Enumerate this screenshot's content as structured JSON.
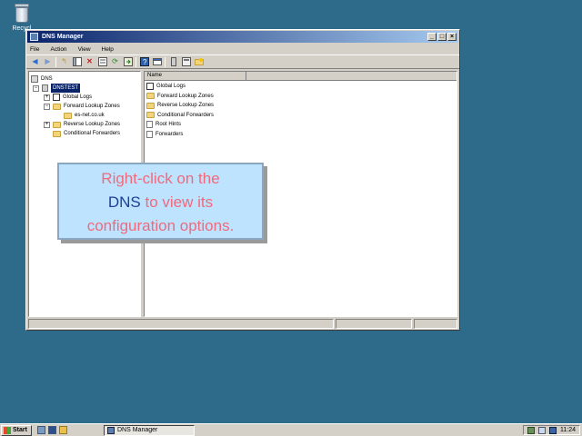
{
  "desktop": {
    "recycle_label": "Recycl"
  },
  "window": {
    "title": "DNS Manager",
    "controls": {
      "minimize": "_",
      "maximize": "□",
      "close": "×"
    }
  },
  "menu": [
    "File",
    "Action",
    "View",
    "Help"
  ],
  "toolbar_icons": [
    "back-icon",
    "forward-icon",
    "up-icon",
    "show-hide-tree-icon",
    "delete-icon",
    "properties-icon",
    "refresh-icon",
    "export-icon",
    "help-icon",
    "new-window-icon",
    "server-icon",
    "zone-icon",
    "folder-icon"
  ],
  "tree": {
    "root": "DNS",
    "server": "DNSTEST",
    "items": [
      {
        "label": "Global Logs",
        "level": 2,
        "expander": "+"
      },
      {
        "label": "Forward Lookup Zones",
        "level": 2,
        "expander": "−"
      },
      {
        "label": "es-net.co.uk",
        "level": 3,
        "expander": ""
      },
      {
        "label": "Reverse Lookup Zones",
        "level": 2,
        "expander": "+"
      },
      {
        "label": "Conditional Forwarders",
        "level": 2,
        "expander": ""
      }
    ]
  },
  "list": {
    "columns": [
      "Name"
    ],
    "items": [
      {
        "label": "Global Logs",
        "icon": "global-logs-icon"
      },
      {
        "label": "Forward Lookup Zones",
        "icon": "folder-icon"
      },
      {
        "label": "Reverse Lookup Zones",
        "icon": "folder-icon"
      },
      {
        "label": "Conditional Forwarders",
        "icon": "folder-icon"
      },
      {
        "label": "Root Hints",
        "icon": "document-icon"
      },
      {
        "label": "Forwarders",
        "icon": "document-icon"
      }
    ]
  },
  "callout": {
    "line1": "Right-click on the",
    "highlight": "DNS",
    "line2_rest": " to view its",
    "line3": "configuration options."
  },
  "taskbar": {
    "start_label": "Start",
    "task_label": "DNS Manager",
    "clock": "11:24"
  }
}
